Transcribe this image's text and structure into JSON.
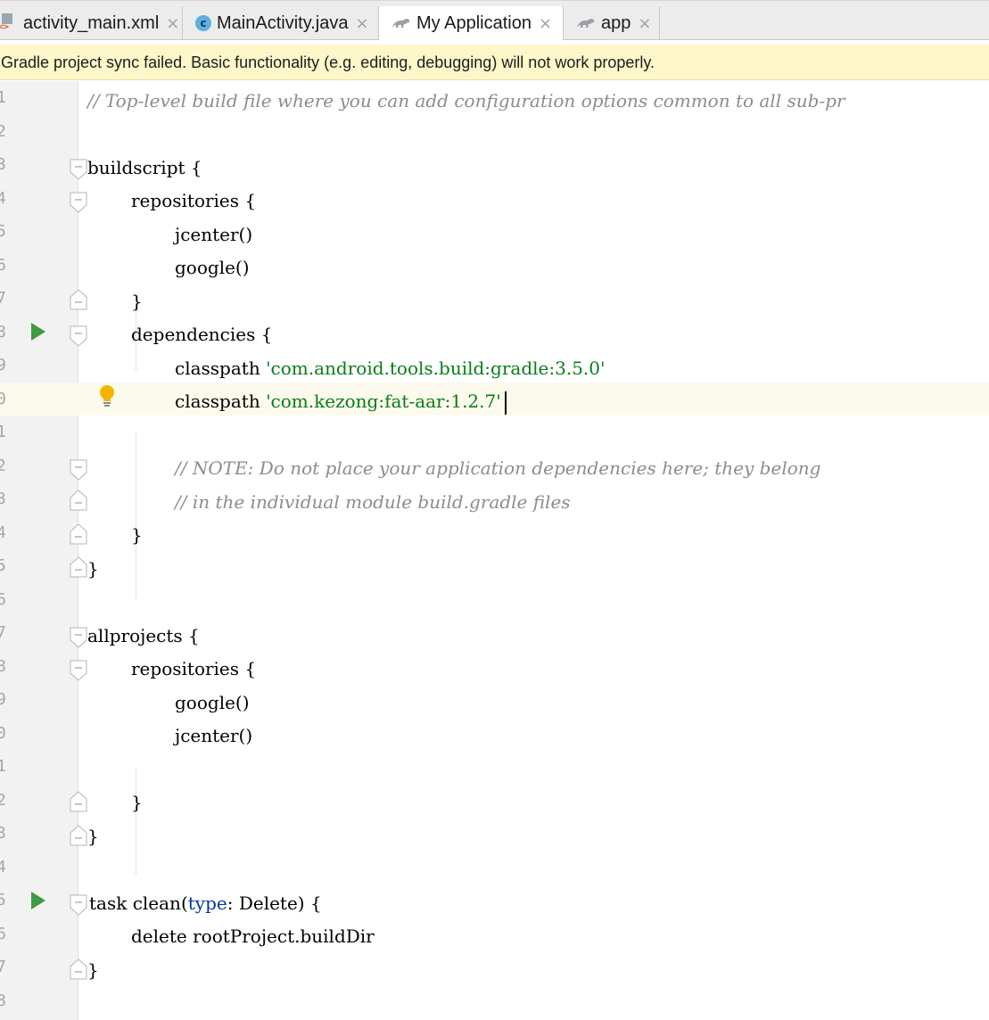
{
  "tabs": [
    {
      "label": "activity_main.xml",
      "icon": "xml-file-icon",
      "active": false
    },
    {
      "label": "MainActivity.java",
      "icon": "java-class-icon",
      "active": false
    },
    {
      "label": "My Application",
      "icon": "gradle-icon",
      "active": true
    },
    {
      "label": "app",
      "icon": "gradle-icon",
      "active": false
    }
  ],
  "close_glyph": "×",
  "class_icon_letter": "c",
  "banner": {
    "message": "Gradle project sync failed. Basic functionality (e.g. editing, debugging) will not work properly."
  },
  "gutter": {
    "line_numbers": [
      "1",
      "2",
      "3",
      "4",
      "5",
      "6",
      "7",
      "8",
      "9",
      "0",
      "1",
      "2",
      "3",
      "4",
      "5",
      "6",
      "7",
      "8",
      "9",
      "0",
      "1",
      "2",
      "3",
      "4",
      "5",
      "6",
      "7",
      "8"
    ]
  },
  "code": {
    "l1_comment": "// Top-level build file where you can add configuration options common to all sub-pr",
    "l3_buildscript": "buildscript {",
    "l4_repositories": "repositories {",
    "l5_jcenter": "jcenter()",
    "l6_google": "google()",
    "l7_close": "}",
    "l8_dependencies": "dependencies {",
    "l9_classpath": "classpath ",
    "l9_string": "'com.android.tools.build:gradle:3.5.0'",
    "l10_classpath": "classpath ",
    "l10_string": "'com.kezong:fat-aar:1.2.7'",
    "l12_comment": "// NOTE: Do not place your application dependencies here; they belong",
    "l13_comment": "// in the individual module build.gradle files",
    "l14_close": "}",
    "l15_close": "}",
    "l17_allprojects": "allprojects {",
    "l18_repositories": "repositories {",
    "l19_google": "google()",
    "l20_jcenter": "jcenter()",
    "l22_close": "}",
    "l23_close": "}",
    "l25_task": "task clean(",
    "l25_type": "type",
    "l25_rest": ": Delete) {",
    "l26_delete": "delete rootProject.buildDir",
    "l27_close": "}"
  },
  "colors": {
    "comment": "#8c8c8c",
    "string": "#067d17",
    "keyword": "#0033b3",
    "banner_bg": "#fdf7c9",
    "run_icon": "#3f9b45",
    "bulb": "#f4b400"
  }
}
